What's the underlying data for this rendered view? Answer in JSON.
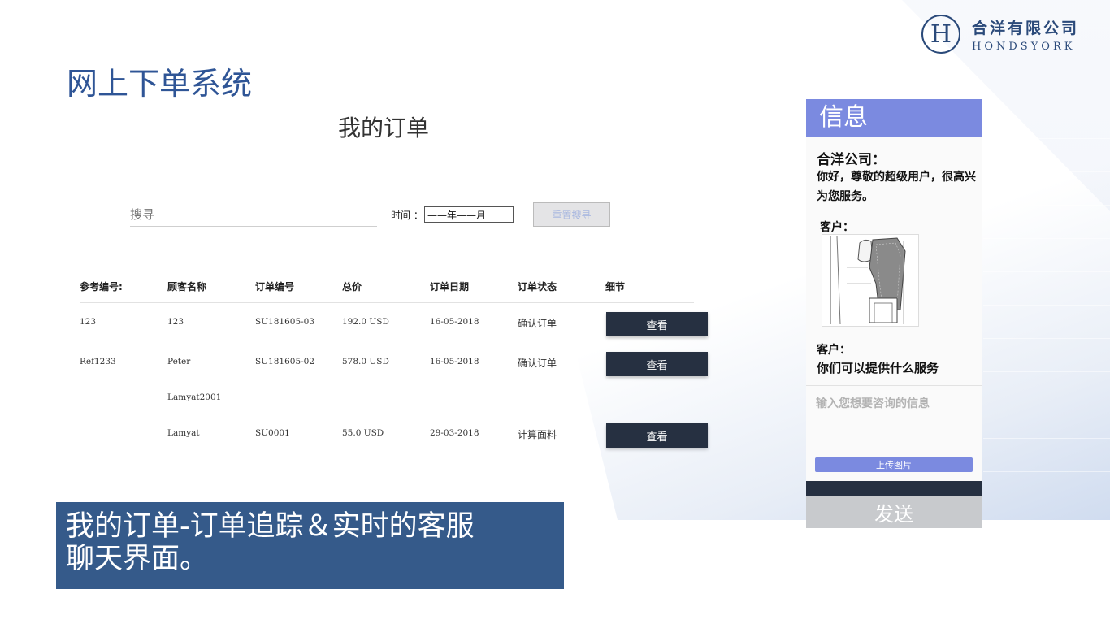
{
  "brand": {
    "logo_letter": "H",
    "name_cn": "合洋有限公司",
    "name_en": "HONDSYORK"
  },
  "page_title": "网上下单系统",
  "orders": {
    "heading": "我的订单",
    "search_placeholder": "搜寻",
    "time_label": "时间 ：",
    "date_value": "——年——月",
    "reset_button": "重置搜寻",
    "columns": [
      "参考编号:",
      "顾客名称",
      "订单编号",
      "总价",
      "订单日期",
      "订单状态",
      "细节"
    ],
    "rows": [
      {
        "ref": "123",
        "customer": "123",
        "order_no": "SU181605-03",
        "total": "192.0 USD",
        "date": "16-05-2018",
        "status": "确认订单",
        "action": "查看"
      },
      {
        "ref": "Ref1233",
        "customer": "Peter",
        "order_no": "SU181605-02",
        "total": "578.0 USD",
        "date": "16-05-2018",
        "status": "确认订单",
        "action": "查看"
      },
      {
        "ref": "",
        "customer": "Lamyat2001",
        "order_no": "",
        "total": "",
        "date": "",
        "status": "",
        "action": ""
      },
      {
        "ref": "",
        "customer": "Lamyat",
        "order_no": "SU0001",
        "total": "55.0 USD",
        "date": "29-03-2018",
        "status": "计算面料",
        "action": "查看"
      }
    ]
  },
  "chat": {
    "header": "信息",
    "company": "合洋公司：",
    "greeting": "你好，尊敬的超级用户，很高兴为您服务。",
    "customer_label_1": "客户：",
    "customer_label_2": "客户：",
    "customer_question": "你们可以提供什么服务",
    "input_placeholder": "输入您想要咨询的信息",
    "upload_button": "上传图片",
    "send_button": "发送"
  },
  "caption": {
    "line1": "我的订单-订单追踪＆实时的客服",
    "line2": "聊天界面。"
  },
  "colors": {
    "title_blue": "#2f5596",
    "chat_header": "#7b8ae0",
    "dark_button": "#263041",
    "caption_bg": "#355a8a"
  }
}
